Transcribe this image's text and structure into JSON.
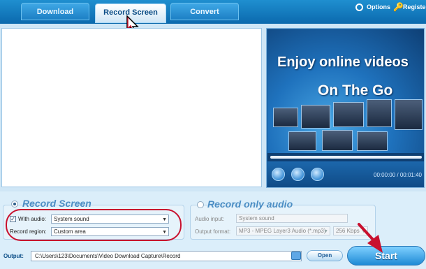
{
  "tabs": [
    {
      "label": "Download"
    },
    {
      "label": "Record Screen"
    },
    {
      "label": "Convert"
    }
  ],
  "top_links": {
    "options": "Options",
    "register": "Registe"
  },
  "video": {
    "headline1": "Enjoy online videos",
    "headline2": "On The Go",
    "time": "00:00:00 / 00:01:40"
  },
  "record_screen": {
    "title": "Record Screen",
    "with_audio_label": "With audio:",
    "with_audio_value": "System sound",
    "region_label": "Record region:",
    "region_value": "Custom area",
    "with_audio_checked": true
  },
  "record_audio": {
    "title": "Record only audio",
    "input_label": "Audio input:",
    "input_value": "System sound",
    "format_label": "Output format:",
    "format_value": "MP3 - MPEG Layer3 Audio (*.mp3)",
    "bitrate_value": "256 Kbps"
  },
  "output": {
    "label": "Output:",
    "path": "C:\\Users\\123\\Documents\\Video Download Capture\\Record",
    "open_label": "Open"
  },
  "start_label": "Start",
  "colors": {
    "accent": "#1e8ad5",
    "highlight": "#c8102e"
  }
}
